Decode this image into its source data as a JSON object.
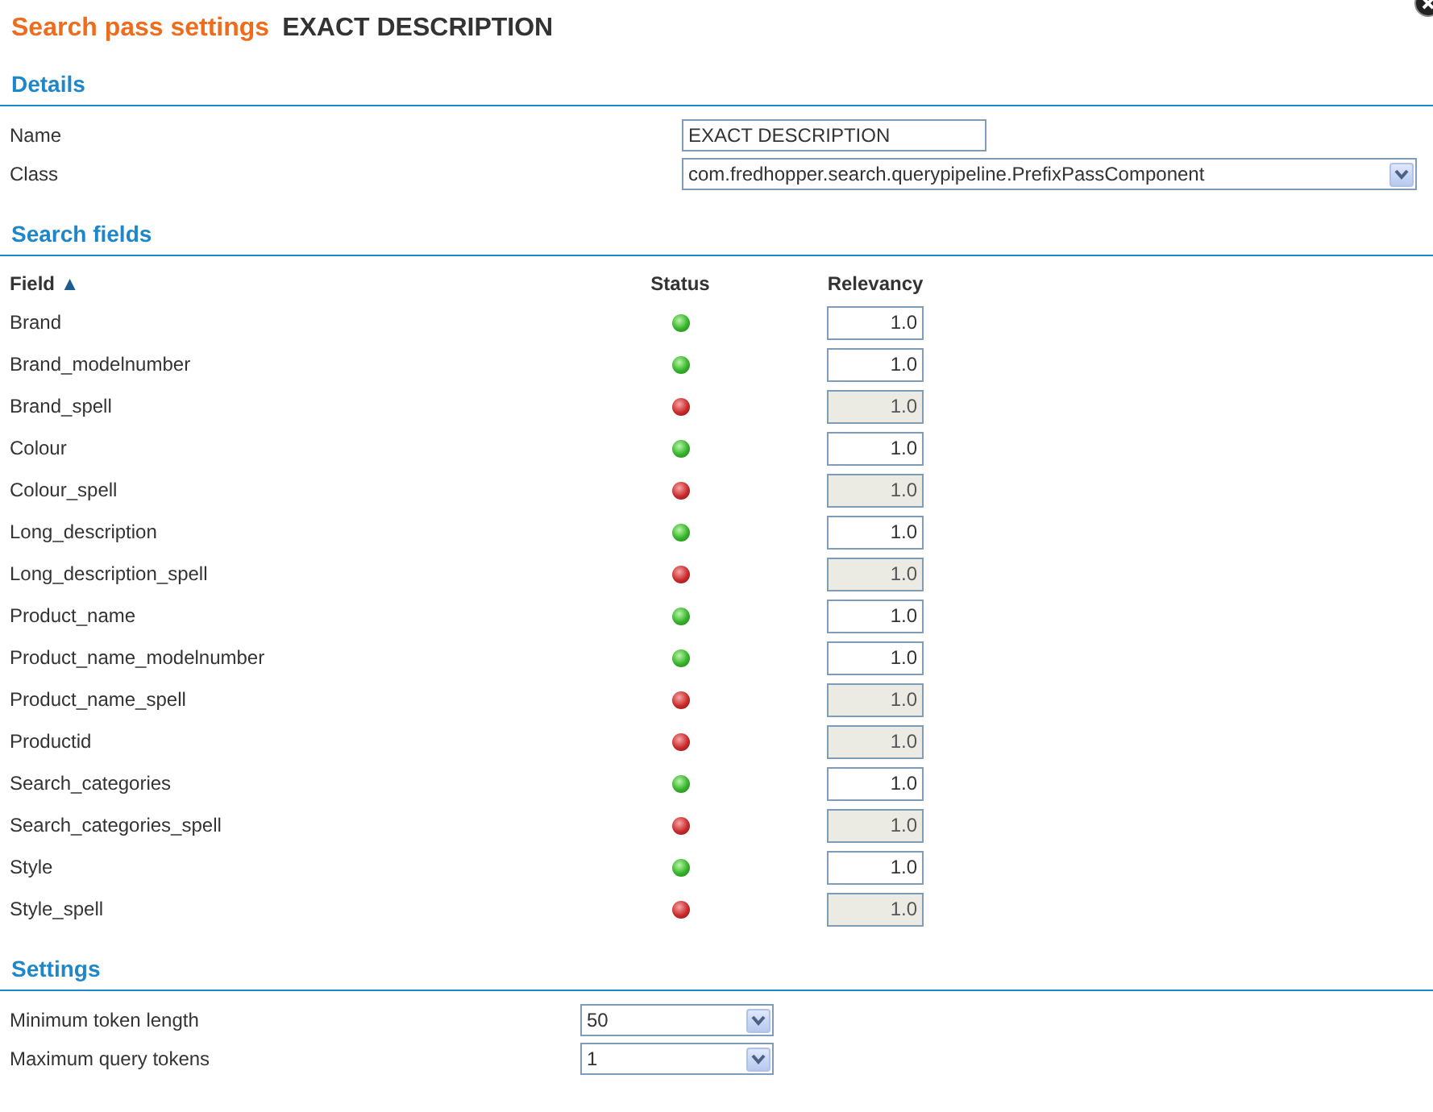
{
  "title": {
    "label": "Search pass settings",
    "value": "EXACT DESCRIPTION"
  },
  "details": {
    "heading": "Details",
    "fields": [
      {
        "kind": "input",
        "label": "Name",
        "value": "EXACT DESCRIPTION"
      },
      {
        "kind": "select",
        "label": "Class",
        "value": "com.fredhopper.search.querypipeline.PrefixPassComponent"
      }
    ]
  },
  "search_fields": {
    "heading": "Search fields",
    "columns": [
      {
        "label": "Field",
        "sort": "▲"
      },
      {
        "label": "Status"
      },
      {
        "label": "Relevancy"
      }
    ],
    "rows": [
      {
        "field": "Brand",
        "active": true,
        "relevancy": "1.0",
        "disabled": false
      },
      {
        "field": "Brand_modelnumber",
        "active": true,
        "relevancy": "1.0",
        "disabled": false
      },
      {
        "field": "Brand_spell",
        "active": false,
        "relevancy": "1.0",
        "disabled": true
      },
      {
        "field": "Colour",
        "active": true,
        "relevancy": "1.0",
        "disabled": false
      },
      {
        "field": "Colour_spell",
        "active": false,
        "relevancy": "1.0",
        "disabled": true
      },
      {
        "field": "Long_description",
        "active": true,
        "relevancy": "1.0",
        "disabled": false
      },
      {
        "field": "Long_description_spell",
        "active": false,
        "relevancy": "1.0",
        "disabled": true
      },
      {
        "field": "Product_name",
        "active": true,
        "relevancy": "1.0",
        "disabled": false
      },
      {
        "field": "Product_name_modelnumber",
        "active": true,
        "relevancy": "1.0",
        "disabled": false
      },
      {
        "field": "Product_name_spell",
        "active": false,
        "relevancy": "1.0",
        "disabled": true
      },
      {
        "field": "Productid",
        "active": false,
        "relevancy": "1.0",
        "disabled": true
      },
      {
        "field": "Search_categories",
        "active": true,
        "relevancy": "1.0",
        "disabled": false
      },
      {
        "field": "Search_categories_spell",
        "active": false,
        "relevancy": "1.0",
        "disabled": true
      },
      {
        "field": "Style",
        "active": true,
        "relevancy": "1.0",
        "disabled": false
      },
      {
        "field": "Style_spell",
        "active": false,
        "relevancy": "1.0",
        "disabled": true
      }
    ]
  },
  "settings": {
    "heading": "Settings",
    "fields": [
      {
        "kind": "select",
        "label": "Minimum token length",
        "value": "50"
      },
      {
        "kind": "select",
        "label": "Maximum query tokens",
        "value": "1"
      }
    ]
  }
}
